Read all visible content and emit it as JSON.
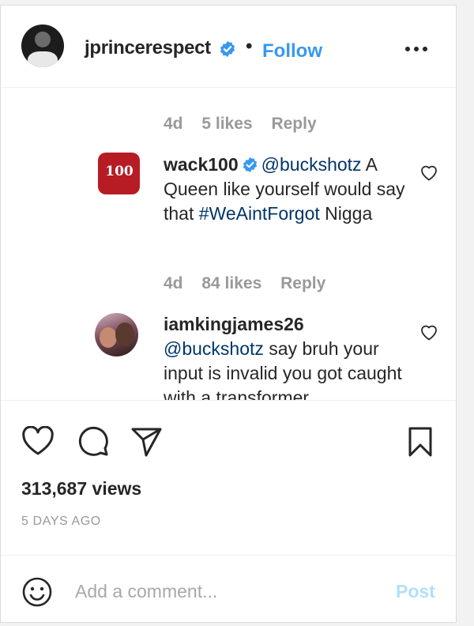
{
  "header": {
    "username": "jprincerespect",
    "separator": "•",
    "follow_label": "Follow",
    "avatar_icon": "user-avatar",
    "verified_icon": "verified-badge-icon",
    "more_icon": "more-options-icon"
  },
  "comments": [
    {
      "meta": {
        "age": "4d",
        "likes": "5 likes",
        "reply": "Reply"
      }
    },
    {
      "username": "wack100",
      "mention": "@buckshotz",
      "text_part1": " A Queen like yourself would say that ",
      "hashtag": "#WeAintForgot",
      "text_part2": " Nigga",
      "avatar_label": "100",
      "meta": {
        "age": "4d",
        "likes": "84 likes",
        "reply": "Reply"
      }
    },
    {
      "username": "iamkingjames26",
      "mention": "@buckshotz",
      "text": " say bruh your input is invalid you got caught with a transformer"
    }
  ],
  "actions": {
    "like_icon": "heart-icon",
    "comment_icon": "comment-bubble-icon",
    "share_icon": "paper-plane-icon",
    "save_icon": "bookmark-icon",
    "views": "313,687 views",
    "time_ago": "5 DAYS AGO"
  },
  "comment_box": {
    "emoji_icon": "smiley-icon",
    "placeholder": "Add a comment...",
    "post_label": "Post"
  },
  "colors": {
    "link_blue": "#3897f0",
    "mention": "#003569",
    "muted": "#999999",
    "post_disabled": "#b2dffc"
  }
}
